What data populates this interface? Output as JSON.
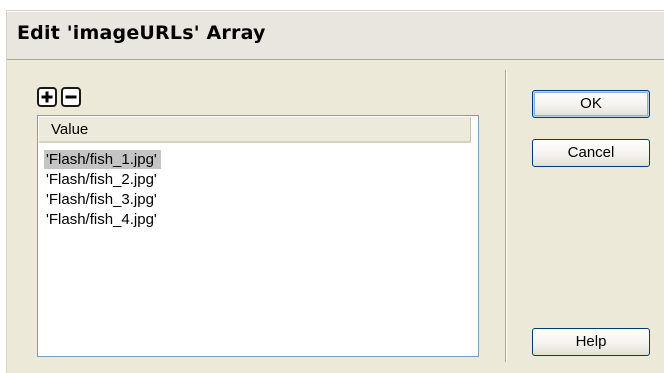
{
  "dialog": {
    "title": "Edit 'imageURLs' Array"
  },
  "toolbar": {
    "add_icon": "plus-icon",
    "remove_icon": "minus-icon"
  },
  "list": {
    "column_header": "Value",
    "items": [
      "'Flash/fish_1.jpg'",
      "'Flash/fish_2.jpg'",
      "'Flash/fish_3.jpg'",
      "'Flash/fish_4.jpg'"
    ],
    "selected_index": 0
  },
  "buttons": {
    "ok_label": "OK",
    "cancel_label": "Cancel",
    "help_label": "Help"
  },
  "colors": {
    "dialog_bg": "#ece9d8",
    "button_border": "#003c74",
    "list_border": "#7f9db9",
    "selection_bg": "#c4c4c4"
  }
}
